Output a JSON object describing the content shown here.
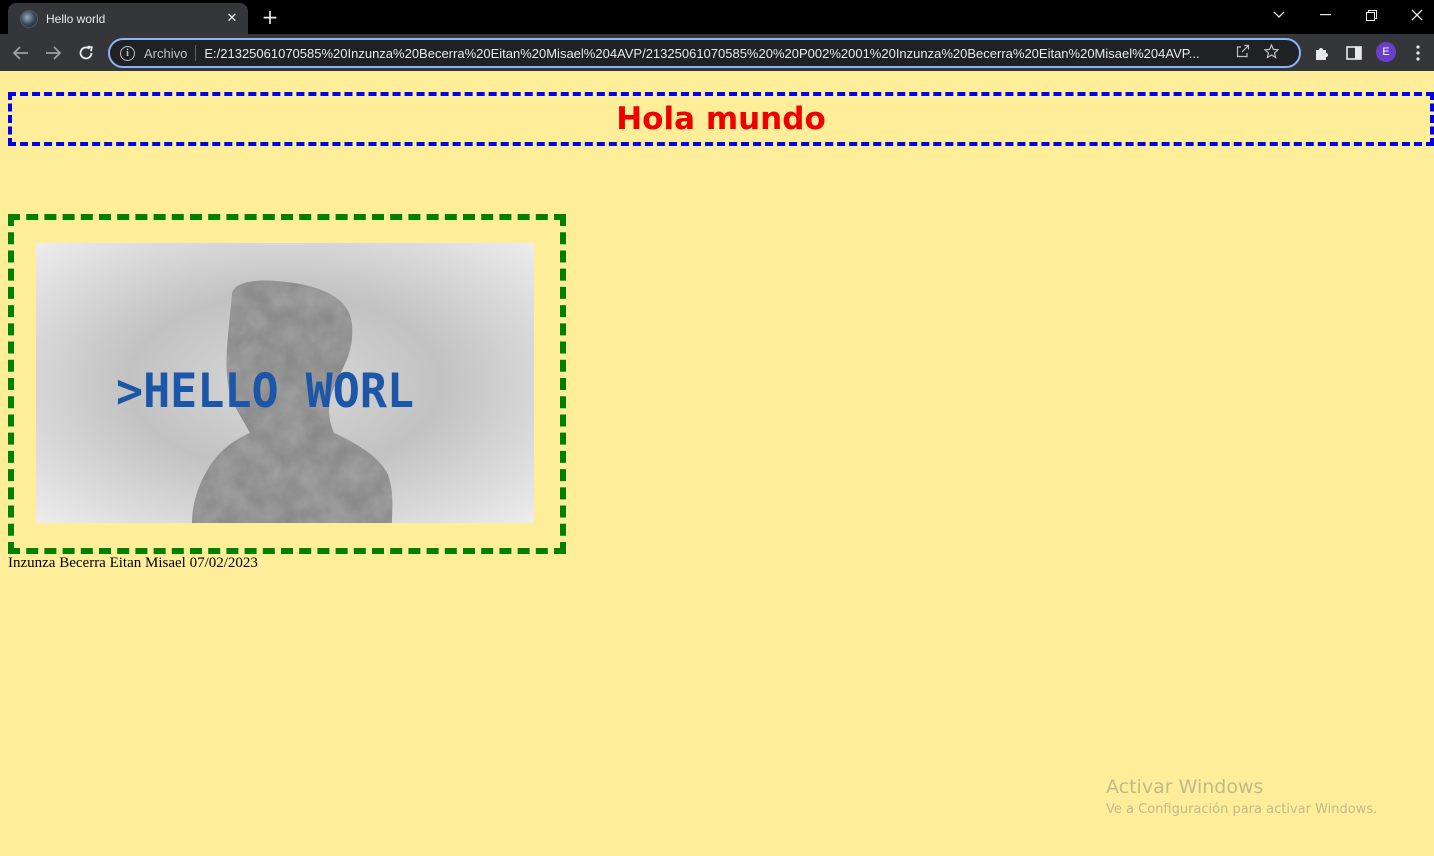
{
  "browser": {
    "tab_title": "Hello world",
    "new_tab_label": "+",
    "address": {
      "scheme_label": "Archivo",
      "url": "E:/21325061070585%20Inzunza%20Becerra%20Eitan%20Misael%204AVP/21325061070585%20%20P002%2001%20Inzunza%20Becerra%20Eitan%20Misael%204AVP..."
    },
    "profile_initial": "E",
    "colors": {
      "chrome": "#35363a",
      "tabstrip": "#000000",
      "omnibox_focus": "#8ab4f8"
    }
  },
  "page": {
    "heading": "Hola mundo",
    "image_text": ">HELLO WORL",
    "caption": "Inzunza Becerra Eitan Misael 07/02/2023",
    "colors": {
      "background": "#ffee99",
      "heading": "#ee0000",
      "heading_border": "#0000ee",
      "figure_border": "#008000"
    }
  },
  "os_watermark": {
    "title": "Activar Windows",
    "subtitle": "Ve a Configuración para activar Windows."
  }
}
